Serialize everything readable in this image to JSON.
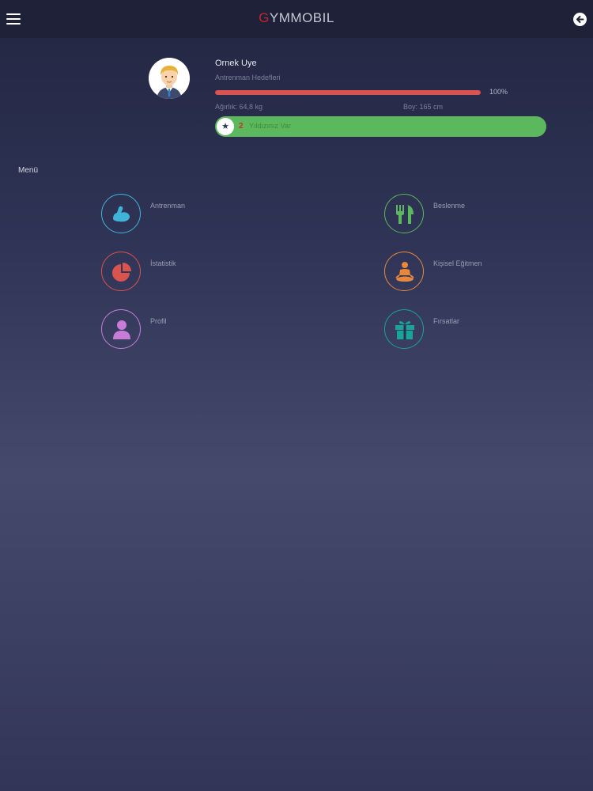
{
  "header": {
    "title_accent": "G",
    "title_rest": "YMMOBIL"
  },
  "user": {
    "name": "Ornek Uye",
    "goal_label": "Antrenman Hedefleri",
    "progress_percent": 100,
    "progress_text": "100%",
    "weight_text": "Ağırlık: 64,8 kg",
    "height_text": "Boy: 165 cm",
    "star_count": "2",
    "star_text": "Yıldızınız Var"
  },
  "menu": {
    "title": "Menü",
    "items": [
      {
        "label": "Antrenman",
        "icon": "muscle-arm-icon",
        "color": "#3fb4d8"
      },
      {
        "label": "Beslenme",
        "icon": "fork-knife-icon",
        "color": "#5cb85c"
      },
      {
        "label": "İstatistik",
        "icon": "pie-chart-icon",
        "color": "#d9534f"
      },
      {
        "label": "Kişisel Eğitmen",
        "icon": "trainer-icon",
        "color": "#e8883a"
      },
      {
        "label": "Profil",
        "icon": "user-icon",
        "color": "#c77dd8"
      },
      {
        "label": "Fırsatlar",
        "icon": "gift-icon",
        "color": "#1aa39a"
      }
    ]
  },
  "colors": {
    "topbar": "#1e2138",
    "progress": "#d9534f",
    "banner": "#5cb85c",
    "accent": "#c0262c"
  }
}
